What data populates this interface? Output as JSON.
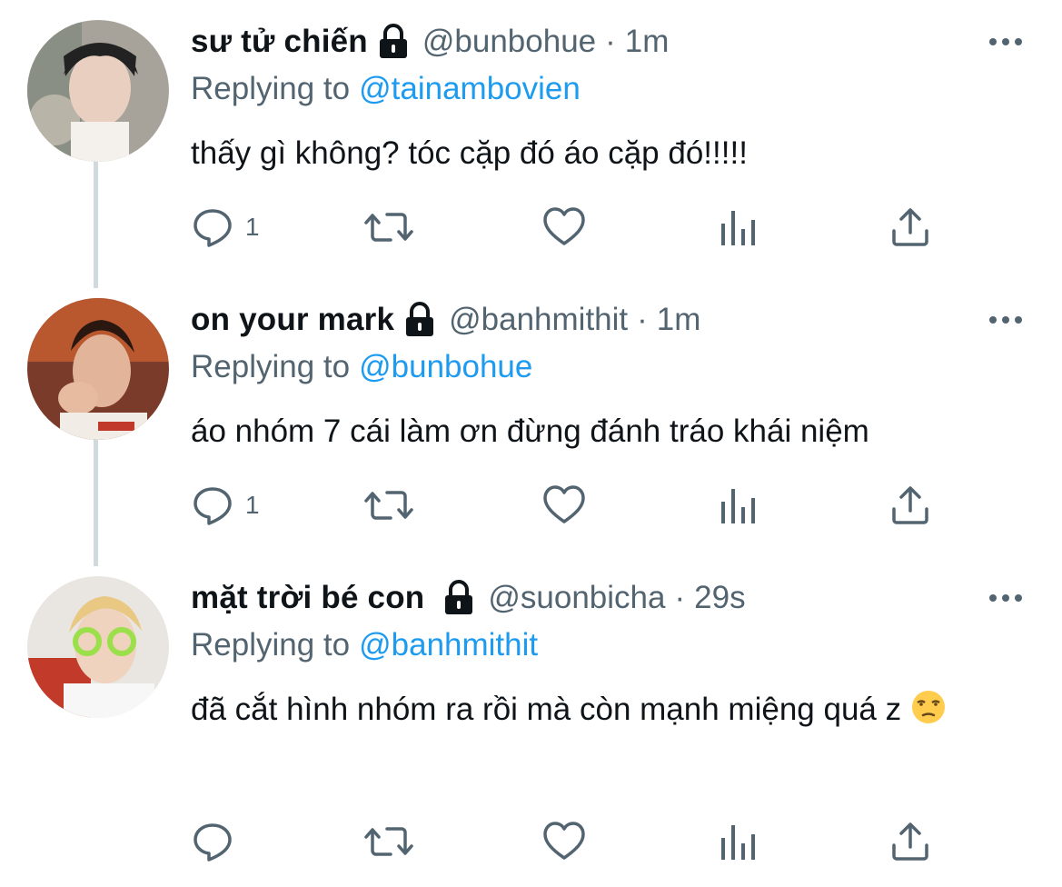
{
  "tweets": [
    {
      "display_name": "sư tử chiến",
      "handle": "@bunbohue",
      "separator": "·",
      "time": "1m",
      "reply_prefix": "Replying to",
      "reply_to": "@tainambovien",
      "text": "thấy gì không? tóc cặp đó áo cặp đó!!!!!",
      "reply_count": "1",
      "emoji": ""
    },
    {
      "display_name": "on your mark",
      "handle": "@banhmithit",
      "separator": "·",
      "time": "1m",
      "reply_prefix": "Replying to",
      "reply_to": "@bunbohue",
      "text": "áo nhóm 7 cái làm ơn đừng đánh tráo khái niệm",
      "reply_count": "1",
      "emoji": ""
    },
    {
      "display_name": "mặt trời bé con",
      "handle": "@suonbicha",
      "separator": "·",
      "time": "29s",
      "reply_prefix": "Replying to",
      "reply_to": "@banhmithit",
      "text": "đã cắt hình nhóm ra rồi mà còn mạnh miệng quá z",
      "reply_count": "",
      "emoji": "unamused-face-emoji"
    }
  ],
  "icons": {
    "lock": "lock-icon",
    "more": "more-options-icon",
    "reply": "reply-icon",
    "retweet": "retweet-icon",
    "like": "like-heart-icon",
    "analytics": "analytics-bar-icon",
    "share": "share-upload-icon"
  },
  "colors": {
    "link": "#1d9bf0",
    "secondary": "#536471",
    "primary_text": "#0f1419",
    "thread_line": "#cfd9de"
  }
}
